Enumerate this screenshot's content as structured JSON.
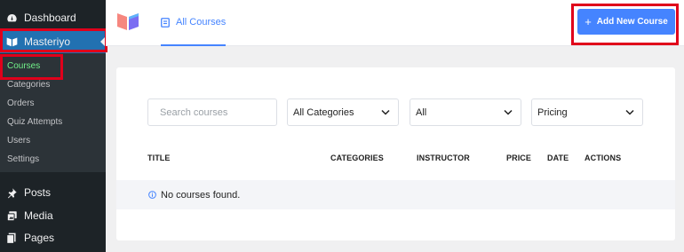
{
  "sidebar": {
    "dashboard": "Dashboard",
    "masteriyo": "Masteriyo",
    "submenu": [
      "Courses",
      "Categories",
      "Orders",
      "Quiz Attempts",
      "Users",
      "Settings"
    ],
    "posts": "Posts",
    "media": "Media",
    "pages": "Pages"
  },
  "header": {
    "tab_label": "All Courses",
    "add_button_plus": "+",
    "add_button_label": "Add New Course"
  },
  "filters": {
    "search_placeholder": "Search courses",
    "categories_value": "All Categories",
    "status_value": "All",
    "pricing_value": "Pricing"
  },
  "table": {
    "columns": [
      "TITLE",
      "CATEGORIES",
      "INSTRUCTOR",
      "PRICE",
      "DATE",
      "ACTIONS"
    ],
    "empty_message": "No courses found."
  },
  "colors": {
    "accent": "#4584ff",
    "sidebar_bg": "#1d2327",
    "active_menu": "#2271b1",
    "active_submenu_text": "#72f28a",
    "highlight_box": "#e0001b"
  },
  "icons": [
    "dashboard-icon",
    "masteriyo-book-icon",
    "pin-icon",
    "media-icon",
    "pages-icon",
    "masteriyo-logo-icon",
    "course-list-icon",
    "plus-icon",
    "chevron-down-icon",
    "info-icon"
  ]
}
